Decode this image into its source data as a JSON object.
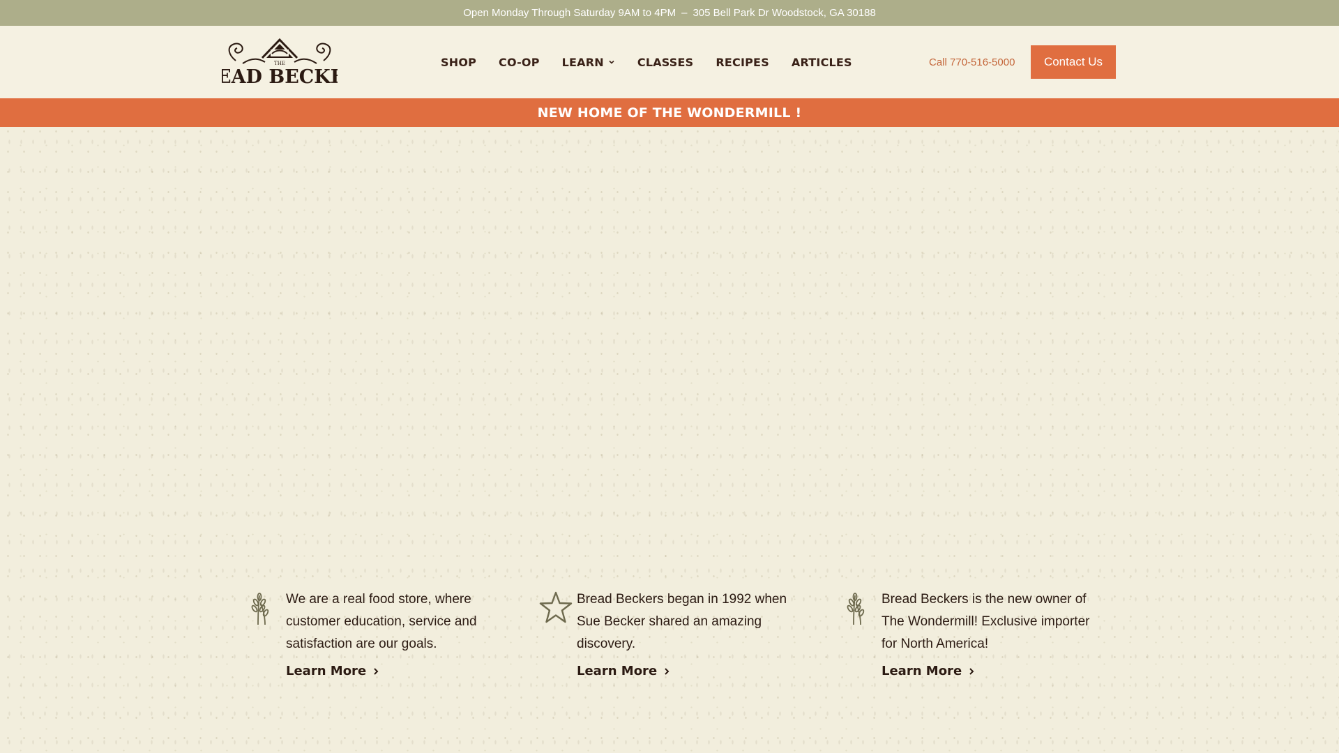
{
  "topbar": {
    "hours": "Open Monday Through Saturday 9AM to 4PM",
    "separator": "–",
    "address": "305 Bell Park Dr Woodstock, GA 30188"
  },
  "header": {
    "logo_text": "BREAD BECKERS",
    "logo_small": "THE",
    "nav": [
      {
        "label": "SHOP"
      },
      {
        "label": "CO-OP"
      },
      {
        "label": "LEARN",
        "has_dropdown": true
      },
      {
        "label": "CLASSES"
      },
      {
        "label": "RECIPES"
      },
      {
        "label": "ARTICLES"
      }
    ],
    "phone": "Call 770-516-5000",
    "contact_label": "Contact Us"
  },
  "announcement": "NEW HOME OF THE WONDERMILL !",
  "features": [
    {
      "icon": "wheat-icon",
      "text": "We are a real food store, where customer education, service and satisfaction are our goals.",
      "link": "Learn More"
    },
    {
      "icon": "star-icon",
      "text": "Bread Beckers began in 1992 when Sue Becker shared an amazing discovery.",
      "link": "Learn More"
    },
    {
      "icon": "wheat-icon",
      "text": "Bread Beckers is the new owner of The Wondermill! Exclusive importer for North America!",
      "link": "Learn More"
    }
  ],
  "colors": {
    "topbar": "#adae8a",
    "accent": "#e06e40",
    "text": "#2b1a12",
    "background": "#f2eedd"
  }
}
